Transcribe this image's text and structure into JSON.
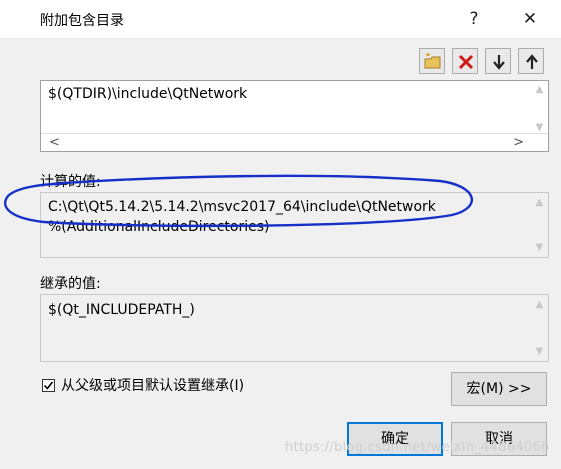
{
  "window": {
    "title": "附加包含目录",
    "help": "?",
    "close": "✕"
  },
  "toolbar": {
    "new_icon": "new-folder-icon",
    "delete_icon": "delete-icon",
    "down_icon": "move-down-icon",
    "up_icon": "move-up-icon"
  },
  "list": {
    "entries": [
      "$(QTDIR)\\include\\QtNetwork"
    ]
  },
  "computed": {
    "label": "计算的值:",
    "lines": [
      "C:\\Qt\\Qt5.14.2\\5.14.2\\msvc2017_64\\include\\QtNetwork",
      "%(AdditionalIncludeDirectories)"
    ]
  },
  "inherited": {
    "label": "继承的值:",
    "lines": [
      "$(Qt_INCLUDEPATH_)"
    ]
  },
  "inherit_checkbox": {
    "label": "从父级或项目默认设置继承(I)",
    "checked": true
  },
  "buttons": {
    "macro": "宏(M) >>",
    "ok": "确定",
    "cancel": "取消"
  },
  "watermark": "https://blog.csdn.net/weixin_44864066",
  "colors": {
    "accent": "#0078d7",
    "annotation": "#1530c8",
    "delete": "#d01818"
  }
}
